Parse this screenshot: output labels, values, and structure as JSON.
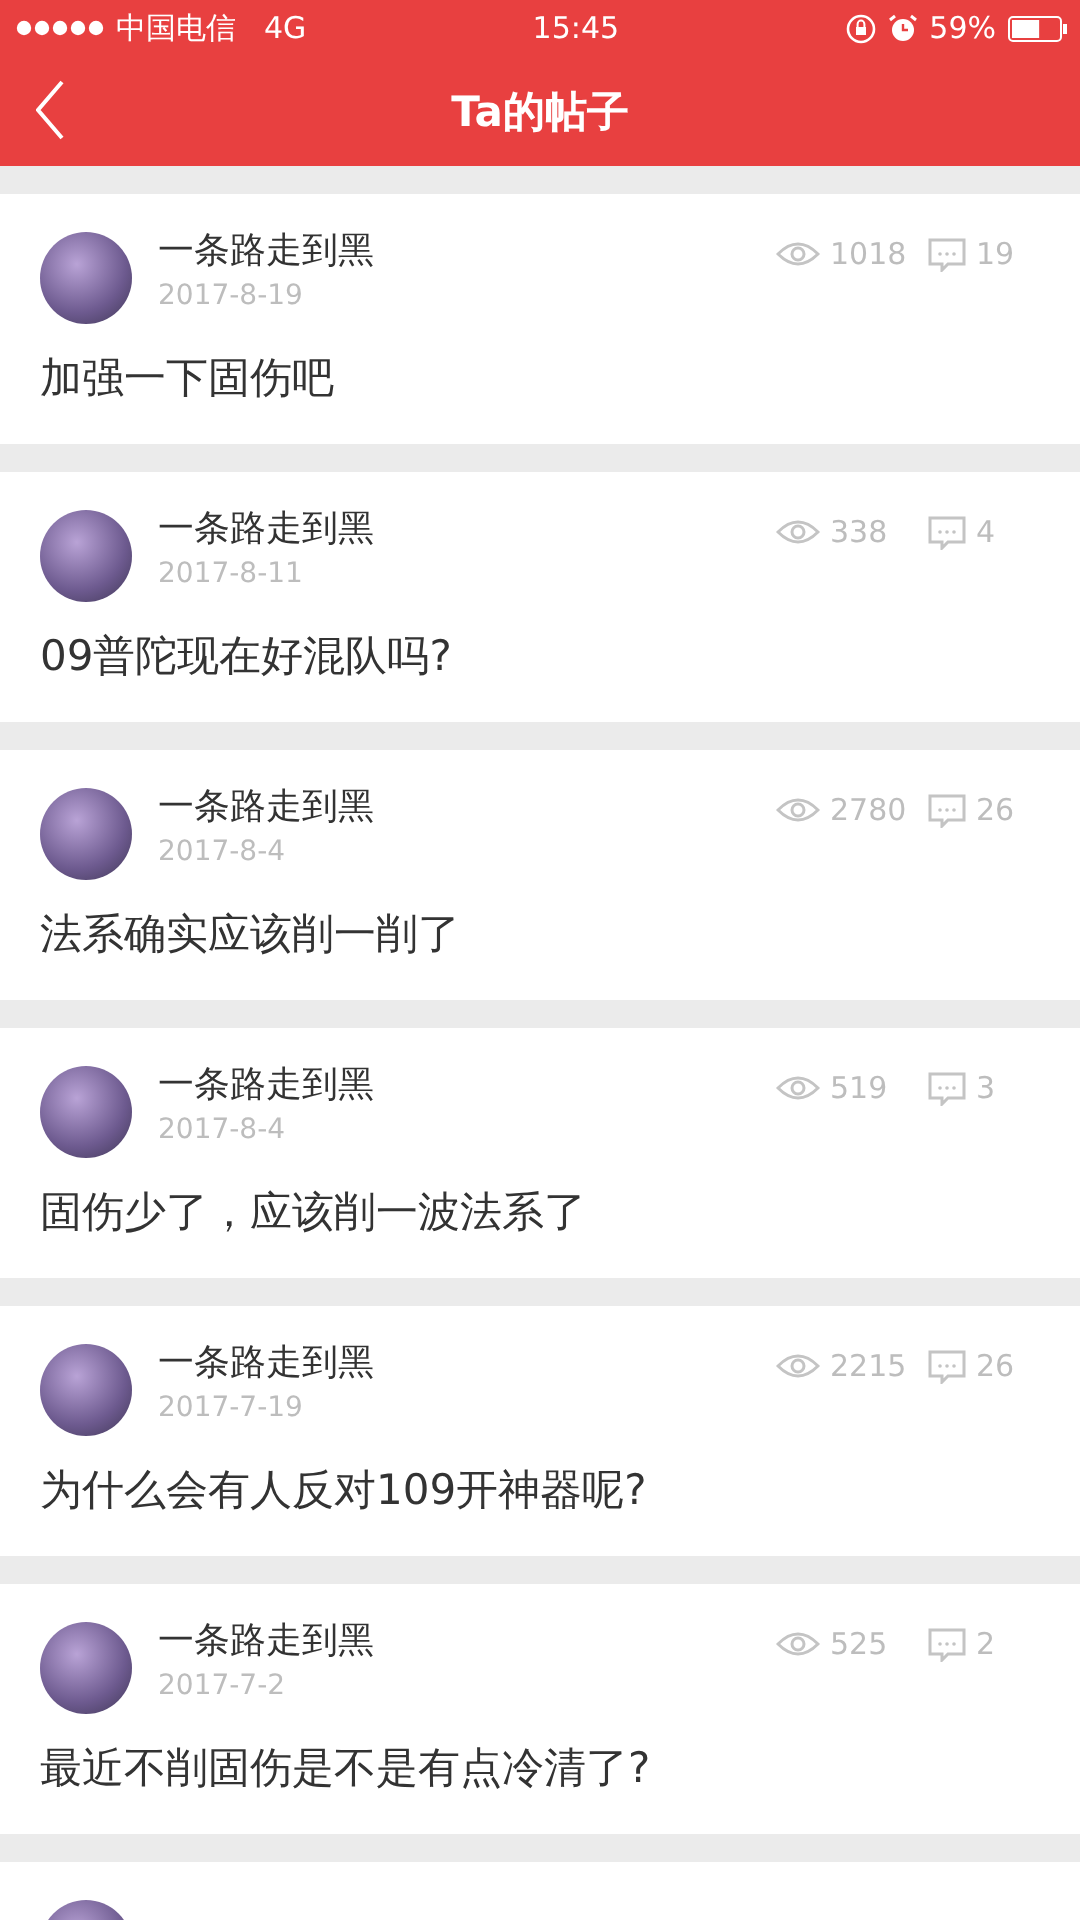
{
  "status_bar": {
    "carrier": "中国电信",
    "network": "4G",
    "time": "15:45",
    "battery": {
      "text": "59%",
      "level": 0.59
    }
  },
  "nav": {
    "title": "Ta的帖子"
  },
  "posts": [
    {
      "author": "一条路走到黑",
      "date": "2017-8-19",
      "views": "1018",
      "comments": "19",
      "title": "加强一下固伤吧"
    },
    {
      "author": "一条路走到黑",
      "date": "2017-8-11",
      "views": "338",
      "comments": "4",
      "title": "09普陀现在好混队吗?"
    },
    {
      "author": "一条路走到黑",
      "date": "2017-8-4",
      "views": "2780",
      "comments": "26",
      "title": "法系确实应该削一削了"
    },
    {
      "author": "一条路走到黑",
      "date": "2017-8-4",
      "views": "519",
      "comments": "3",
      "title": "固伤少了，应该削一波法系了"
    },
    {
      "author": "一条路走到黑",
      "date": "2017-7-19",
      "views": "2215",
      "comments": "26",
      "title": "为什么会有人反对109开神器呢?"
    },
    {
      "author": "一条路走到黑",
      "date": "2017-7-2",
      "views": "525",
      "comments": "2",
      "title": "最近不削固伤是不是有点冷清了?"
    }
  ]
}
